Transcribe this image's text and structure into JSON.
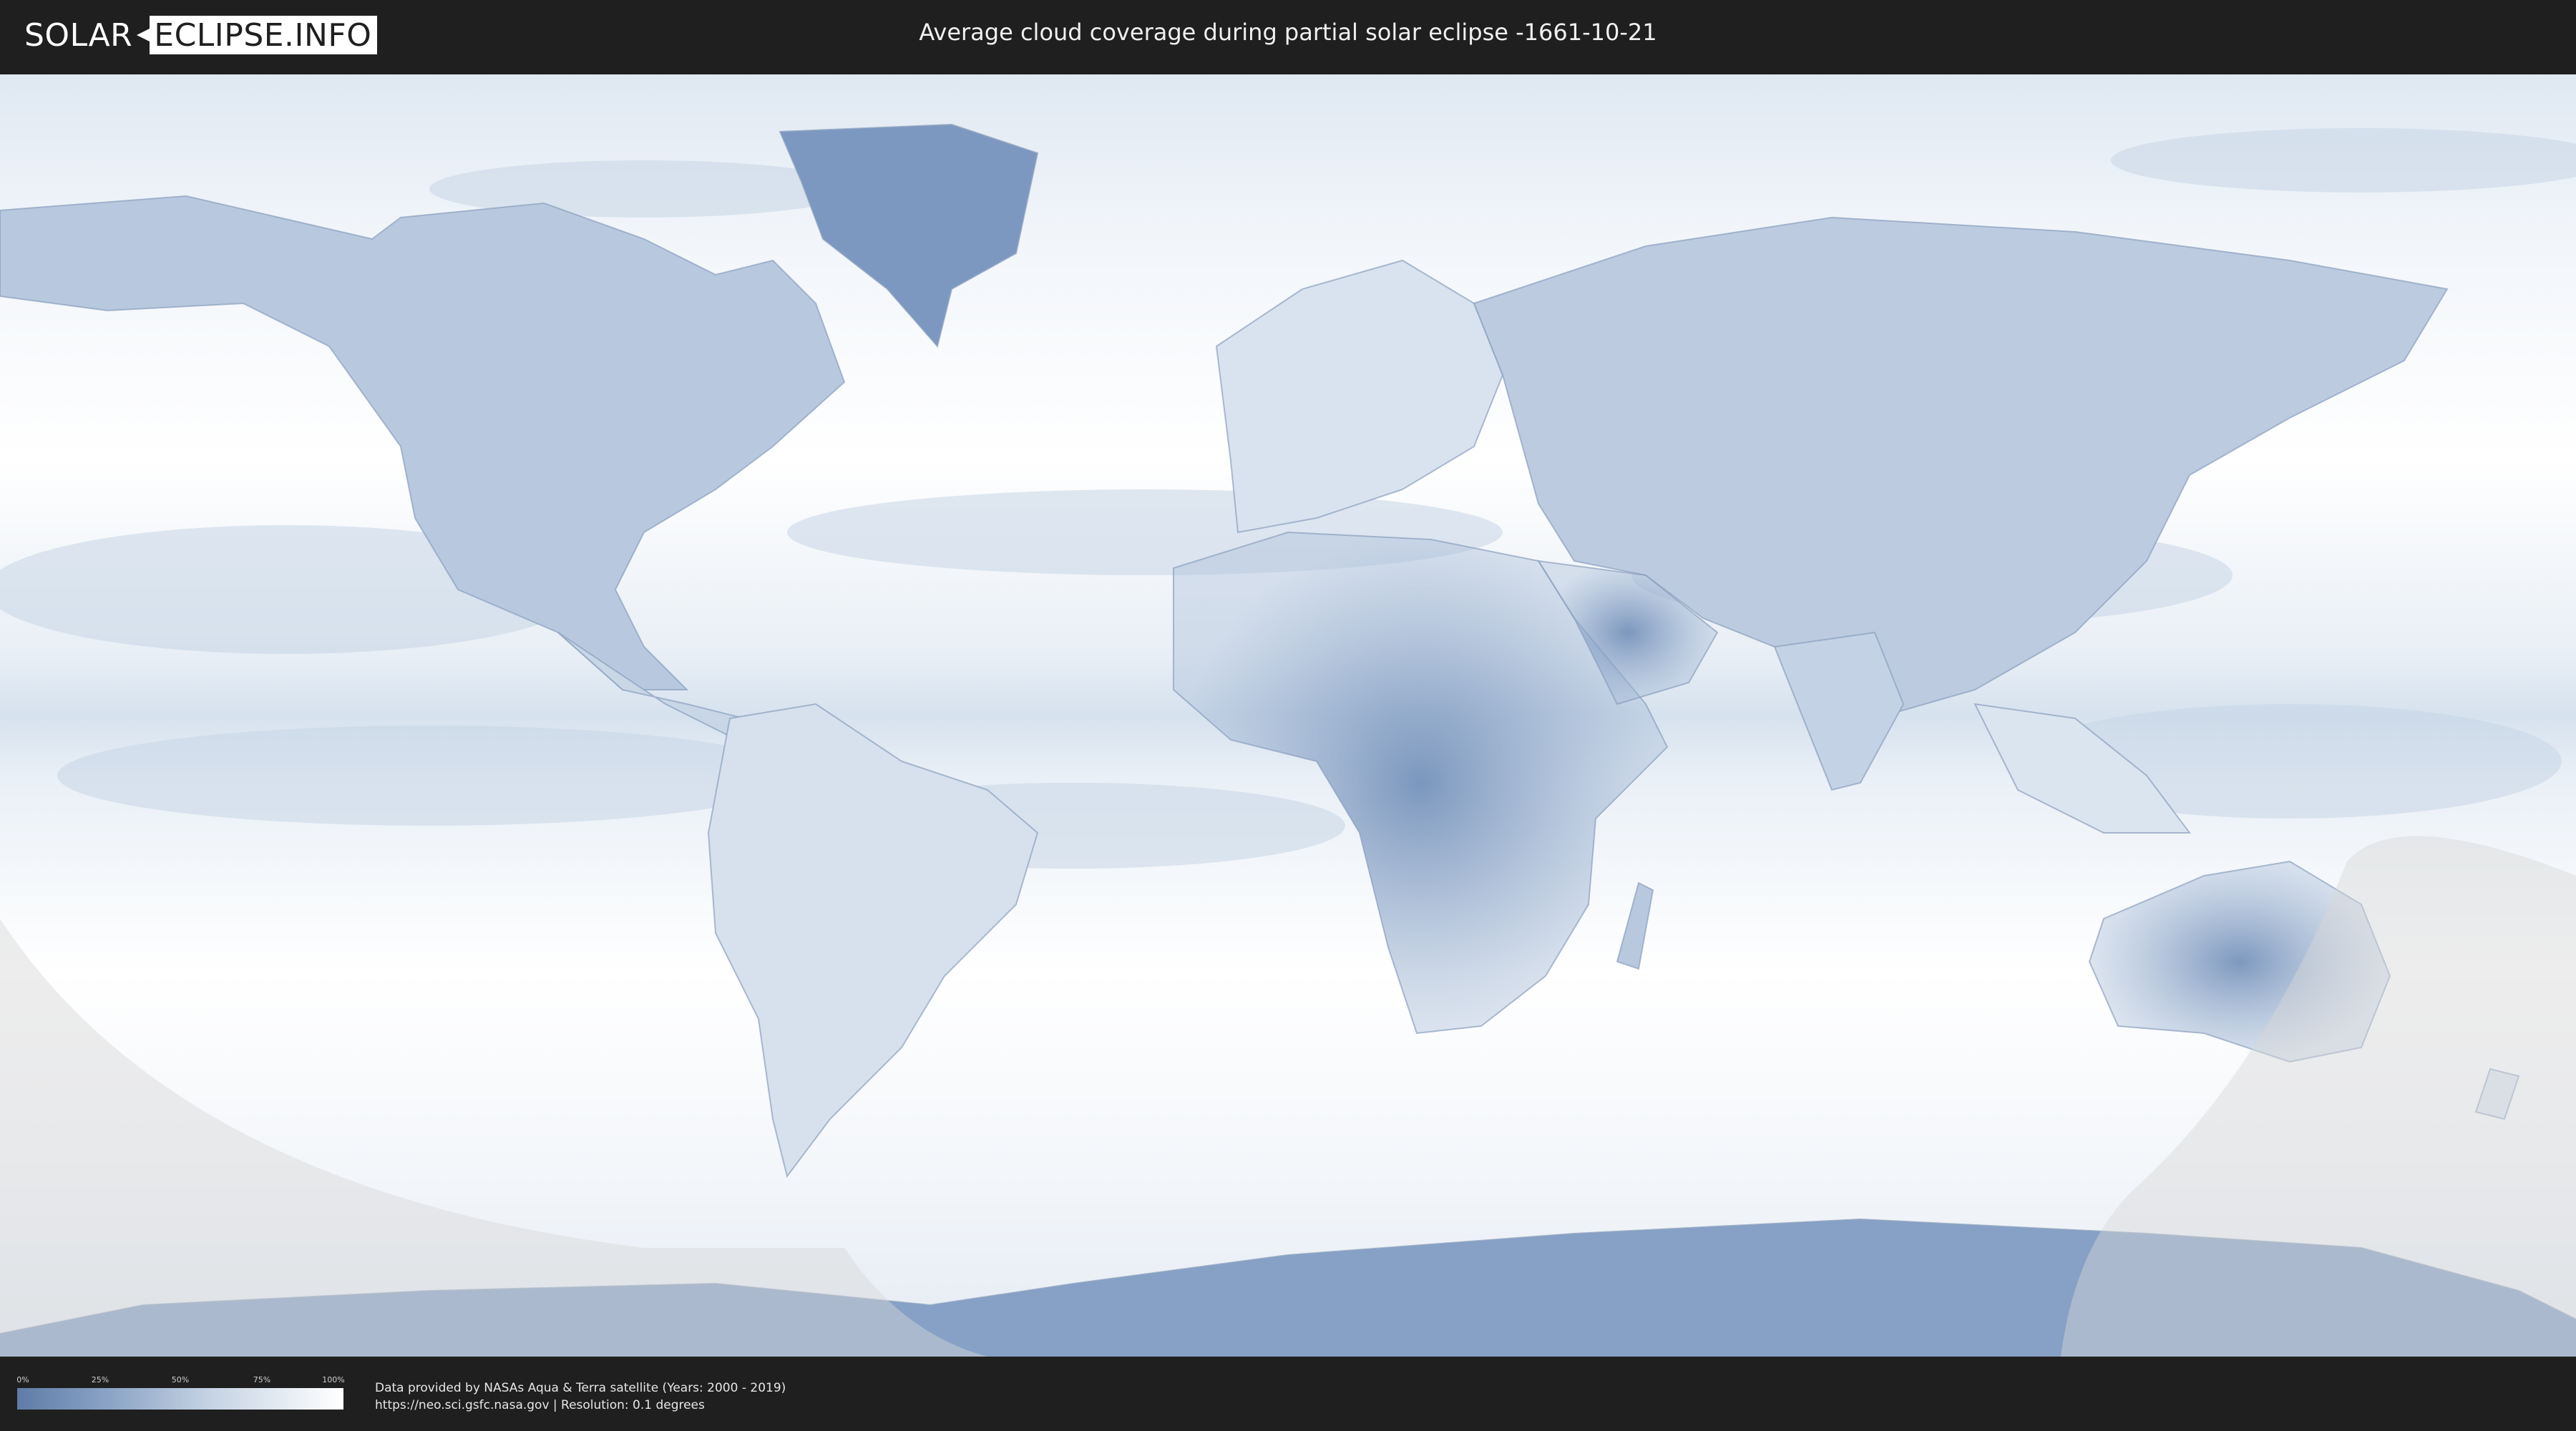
{
  "header": {
    "logo_left": "SOLAR",
    "logo_right": "ECLIPSE.INFO",
    "title": "Average cloud coverage during partial solar eclipse -1661-10-21"
  },
  "map": {
    "colors": {
      "clear": "#5f7ca7",
      "cloudy": "#ffffff",
      "eclipse_overlay": "#d8d8d8"
    }
  },
  "legend": {
    "ticks": [
      "0%",
      "25%",
      "50%",
      "75%",
      "100%"
    ],
    "colors": [
      "#5f7ca7",
      "#ffffff"
    ]
  },
  "footer": {
    "source_line1": "Data provided by NASAs Aqua & Terra satellite (Years: 2000 - 2019)",
    "source_line2": "https://neo.sci.gsfc.nasa.gov | Resolution: 0.1 degrees"
  }
}
